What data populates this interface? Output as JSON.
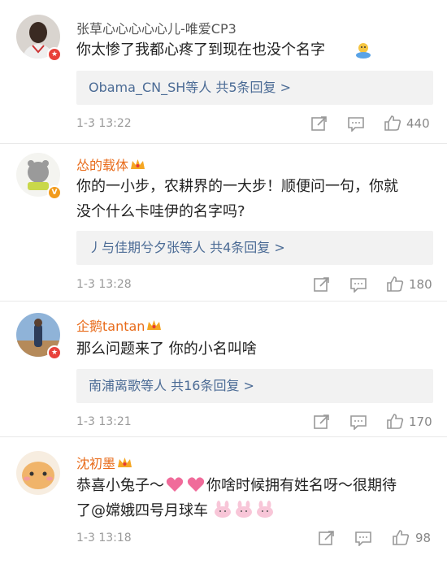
{
  "comments": [
    {
      "username": "张草心心心心心儿-唯爱CP3",
      "text": "你太惨了我都心疼了到现在也没个名字",
      "replies": "Obama_CN_SH等人  共5条回复 >",
      "time": "1-3 13:22",
      "likes": "440",
      "name_color": "#555555",
      "badge": "red"
    },
    {
      "username": "怂的载体",
      "text_line1": "你的一小步，农耕界的一大步！顺便问一句，你就",
      "text_line2": "没个什么卡哇伊的名字吗?",
      "replies": "丿与佳期兮夕张等人  共4条回复 >",
      "time": "1-3 13:28",
      "likes": "180",
      "name_color": "#e86b1a",
      "badge": "orange"
    },
    {
      "username": "企鹅tantan",
      "text": "那么问题来了 你的小名叫啥",
      "replies": "南浦离歌等人  共16条回复 >",
      "time": "1-3 13:21",
      "likes": "170",
      "name_color": "#e86b1a",
      "badge": "red"
    },
    {
      "username": "沈初墨",
      "text_line1_a": "恭喜小兔子～",
      "text_line1_b": "你啥时候拥有姓名呀～很期待",
      "text_line2": "了@嫦娥四号月球车",
      "time": "1-3 13:18",
      "likes": "98",
      "name_color": "#e86b1a"
    }
  ],
  "icons": {
    "share": "share-icon",
    "comment": "comment-icon",
    "like": "thumbs-up-icon",
    "crown": "vip-crown-icon"
  },
  "colors": {
    "link": "#4b6b95",
    "orange_name": "#e86b1a",
    "badge_red": "#e8413a",
    "badge_orange": "#f29b1b",
    "reply_bg": "#f2f2f2"
  }
}
